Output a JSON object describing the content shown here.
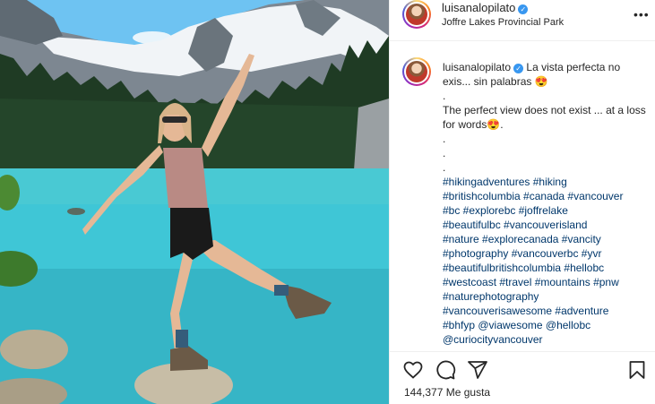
{
  "header": {
    "username": "luisanalopilato",
    "location": "Joffre Lakes Provincial Park",
    "more_label": "•••"
  },
  "caption": {
    "username": "luisanalopilato",
    "text_1": "La vista perfecta no exis... sin palabras 😍",
    "dot_1": ".",
    "text_2": "The perfect view does not exist ... at a loss for words😍.",
    "dot_2": ".",
    "dot_3": ".",
    "dot_4": ".",
    "hashtag_lines": [
      "#hikingadventures #hiking",
      "#britishcolumbia #canada #vancouver",
      "#bc #explorebc #joffrelake",
      "#beautifulbc #vancouverisland",
      "#nature #explorecanada #vancity",
      "#photography #vancouverbc #yvr",
      "#beautifulbritishcolumbia #hellobc",
      "#westcoast #travel #mountains #pnw",
      "#naturephotography",
      "#vancouverisawesome #adventure",
      "#bhfyp @viawesome @hellobc",
      "@curiocityvancouver"
    ]
  },
  "actions": {
    "likes_text": "144,377 Me gusta"
  },
  "icons": {
    "like": "heart-icon",
    "comment": "comment-icon",
    "share": "paper-plane-icon",
    "save": "bookmark-icon",
    "verified": "verified-badge-icon"
  },
  "colors": {
    "verified": "#3897f0",
    "hashtag": "#00376b",
    "text": "#262626",
    "lake": "#3fc6d6"
  }
}
